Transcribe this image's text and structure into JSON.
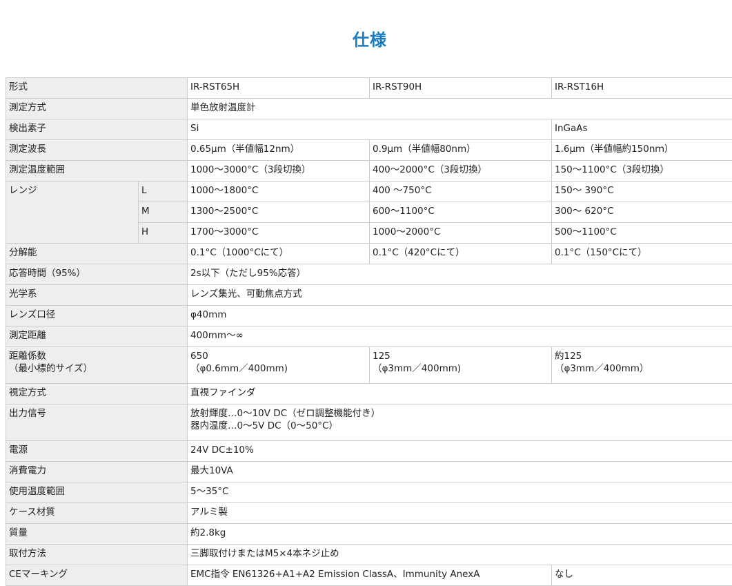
{
  "page_title": "仕様",
  "model_label": "形式",
  "models": [
    "IR-RST65H",
    "IR-RST90H",
    "IR-RST16H"
  ],
  "measure_method": {
    "label": "測定方式",
    "value": "単色放射温度計"
  },
  "detector": {
    "label": "検出素子",
    "si": "Si",
    "ingaas": "InGaAs"
  },
  "wavelength": {
    "label": "測定波長",
    "values": [
      "0.65μm（半値幅12nm）",
      "0.9μm（半値幅80nm）",
      "1.6μｍ（半値幅約150nｍ）"
    ]
  },
  "temp_range": {
    "label": "測定温度範囲",
    "values": [
      "1000〜3000°C（3段切換）",
      "400〜2000°C（3段切換）",
      "150〜1100°C（3段切換）"
    ]
  },
  "range": {
    "label": "レンジ",
    "rows": [
      {
        "sub": "L",
        "values": [
          "1000〜1800°C",
          "400 〜750°C",
          "150〜 390°C"
        ]
      },
      {
        "sub": "M",
        "values": [
          "1300〜2500°C",
          "600〜1100°C",
          "300〜 620°C"
        ]
      },
      {
        "sub": "H",
        "values": [
          "1700〜3000°C",
          "1000〜2000°C",
          "500〜1100°C"
        ]
      }
    ]
  },
  "resolution": {
    "label": "分解能",
    "values": [
      "0.1°C（1000°Cにて）",
      "0.1°C（420°Cにて）",
      "0.1°C（150°Cにて）"
    ]
  },
  "response": {
    "label": "応答時間（95%）",
    "value": "2s以下（ただし95%応答）"
  },
  "optics": {
    "label": "光学系",
    "value": "レンズ集光、可動焦点方式"
  },
  "lens": {
    "label": "レンズ口径",
    "value": "φ40mm"
  },
  "distance": {
    "label": "測定距離",
    "value": "400mm〜∞"
  },
  "distance_factor": {
    "label1": "距離係数",
    "label2": "（最小標的サイズ）",
    "values": [
      {
        "line1": "650",
        "line2": "（φ0.6mm／400mm)"
      },
      {
        "line1": "125",
        "line2": "（φ3mm／400mm)"
      },
      {
        "line1": "約125",
        "line2": "（φ3mm／400mm）"
      }
    ]
  },
  "sighting": {
    "label": "視定方式",
    "value": "直視ファインダ"
  },
  "output": {
    "label": "出力信号",
    "line1": "放射輝度…0〜10V DC（ゼロ調整機能付き）",
    "line2": "器内温度…0〜5V DC（0〜50°C）"
  },
  "power": {
    "label": "電源",
    "value": "24V DC±10%"
  },
  "consumption": {
    "label": "消費電力",
    "value": "最大10VA"
  },
  "operating_temp": {
    "label": "使用温度範囲",
    "value": "5〜35°C"
  },
  "case": {
    "label": "ケース材質",
    "value": "アルミ製"
  },
  "mass": {
    "label": "質量",
    "value": "約2.8kg"
  },
  "mounting": {
    "label": "取付方法",
    "value": "三脚取付けまたはM5×4本ネジ止め"
  },
  "ce": {
    "label": "CEマーキング",
    "value": "EMC指令 EN61326+A1+A2 Emission ClassA、Immunity AnexA",
    "value_16h": "なし"
  }
}
